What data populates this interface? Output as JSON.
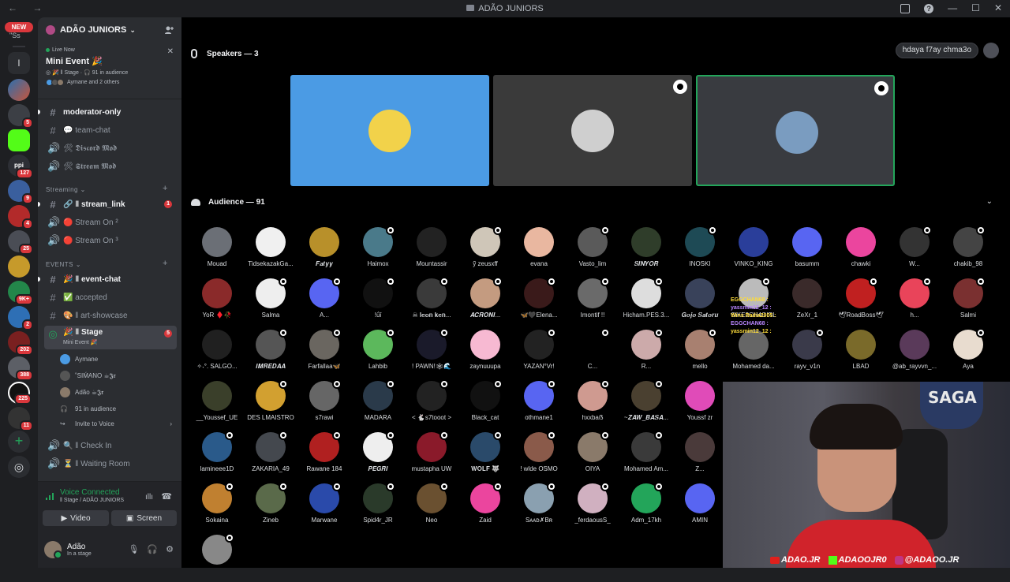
{
  "titlebar": {
    "title": "ADÃO JUNIORS",
    "nav": "← →"
  },
  "rail": {
    "new_label": "NEW",
    "top_text": "\"Ss",
    "badges": [
      "5",
      "127",
      "9",
      "4",
      "25",
      "9K+",
      "2",
      "202",
      "388",
      "225",
      "11"
    ]
  },
  "server": {
    "name": "ADÃO JUNIORS",
    "live_label": "Live Now",
    "event_name": "Mini Event 🎉",
    "event_meta_stage": "ǁ Stage",
    "event_meta_audience": "91 in audience",
    "attendees": "Aymane and 2 others"
  },
  "channels": [
    {
      "name": "moderator-only",
      "icon": "hash"
    },
    {
      "name": "team-chat",
      "icon": "speech"
    },
    {
      "name": "𝕯𝖎𝖘𝖈𝖔𝖗𝖉 𝕸𝖔𝖉",
      "icon": "tools"
    },
    {
      "name": "𝕾𝖙𝖗𝖊𝖆𝖒 𝕸𝖔𝖉",
      "icon": "tools"
    }
  ],
  "category_streaming": "Streaming ⌄",
  "streaming_channels": [
    {
      "name": "ǁ stream_link",
      "badge": "1"
    },
    {
      "name": "Stream On ²"
    },
    {
      "name": "Stream On ³"
    }
  ],
  "category_events": "EVENTS ⌄",
  "event_channels": [
    {
      "name": "ǁ event-chat"
    },
    {
      "name": "accepted"
    },
    {
      "name": "ǁ art-showcase"
    }
  ],
  "stage_channel": {
    "name": "ǁ Stage",
    "sub": "Mini Event 🎉",
    "badge": "5"
  },
  "stage_users": [
    {
      "name": "Aymane"
    },
    {
      "name": "˚SIḾANO ☕𝕵𝖗"
    },
    {
      "name": "Adão ☕𝕵𝖗"
    }
  ],
  "stage_audience": "91 in audience",
  "invite": "Invite to Voice",
  "other_channels": [
    {
      "name": "ǁ Check In"
    },
    {
      "name": "ǁ Waiting Room"
    }
  ],
  "voice": {
    "status": "Voice Connected",
    "location": "ǁ Stage / ADÃO JUNIORS",
    "video_label": "Video",
    "screen_label": "Screen"
  },
  "user": {
    "name": "Adão",
    "status": "In a stage"
  },
  "stage": {
    "speakers_label": "Speakers — 3",
    "audience_label": "Audience — 91",
    "top_pill": "hdaya f7ay chma3o"
  },
  "audience": [
    [
      "Mouad",
      "TidsekazakGa...",
      "𝑭𝒂𝒕𝒚𝒚",
      "Haimox",
      "Mountassir",
      "ỹ zeusxff",
      "evana",
      "Vasto_lim",
      "𝑺𝑰𝑵𝒀𝑶𝑹",
      "INOSKI",
      "VINKO_KING",
      "basumm",
      "chawki",
      "W...",
      "chakib_98"
    ],
    [
      "YoR ♦️🥀",
      "Salma",
      "A...",
      "!ǘǐ",
      "☠ 𝐥𝐞𝐨𝐧 𝐤𝐞𝐧...",
      "𝑨𝑪𝑹𝑶𝑵𝑰...",
      "🦋🖤Elena...",
      "Imontif !!",
      "Hicham.PES.3...",
      "𝑮𝒐𝒋𝒐 𝑺𝒂𝒕𝒐𝒓𝒖",
      "SIKE2CH4GIRL",
      "ZeXr_1",
      "🕊RoadBoss🕊",
      "h...",
      "Salmi"
    ],
    [
      "✧˖°. SALGO...",
      "𝑰𝑴𝑹𝑬𝑫𝑨𝑨",
      "Farfallaa🦋",
      "Lahbib",
      "! PAWN!🕸🌊",
      "zaynuuupa",
      "YAZAN°Vr!",
      "C...",
      "R...",
      "mello",
      "Mohamed da...",
      "rayv_v1n",
      "LBAD",
      "@ab_rayvvn_...",
      "Aya"
    ],
    [
      "__Youssef_UE",
      "DES LMAISTRO",
      "s7rawi",
      "MADARA",
      "< 🐇s7tooot >",
      "Black_cat",
      "othmane1",
      "hxxbaẞ",
      "~𝒁𝑨𝑾_𝑩𝑨𝑺𝑨...",
      "Youssf zr"
    ],
    [
      "lamineee1D",
      "ZAKARIA_49",
      "Rawane 184",
      "𝑷𝑬𝑮𝑹𝑰",
      "mustapha UW",
      "𝐖𝐎𝐋𝐅 🐺",
      "! wlde OSMO",
      "OIYA",
      "Mohamed Am...",
      "Z..."
    ],
    [
      "Sokaina",
      "Zineb",
      "Marwane",
      "Spid4r_JR",
      "Neo",
      "Zaid",
      "Sᴀᴀᴅ✗Bʀ",
      "_ferdaousS_",
      "Adm_17kh",
      "AMIN"
    ],
    [
      ""
    ]
  ],
  "chat_overlay": [
    "EGGCHAN68 :",
    "yassmin12_12 :",
    "Wins Radia2005 :",
    "EGGCHAN68 :",
    "yassmin12_12 :"
  ],
  "cam": {
    "handles": [
      "ADAO.JR",
      "ADAOOJR0",
      "@ADAOO.JR"
    ],
    "wall_logo": "SAGA"
  },
  "colors": {
    "accent": "#23a55a",
    "tile_blue": "#4b9be4",
    "tile_dark": "#3a3a3a",
    "badge_red": "#da373c"
  }
}
